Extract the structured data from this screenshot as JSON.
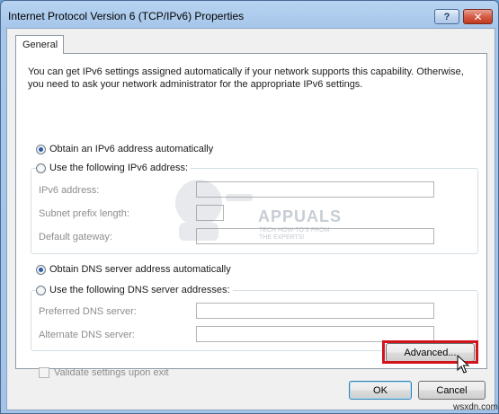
{
  "window": {
    "title": "Internet Protocol Version 6 (TCP/IPv6) Properties",
    "help_label": "?",
    "close_label": "✕"
  },
  "tabs": [
    {
      "label": "General",
      "selected": true
    }
  ],
  "intro_text": "You can get IPv6 settings assigned automatically if your network supports this capability. Otherwise, you need to ask your network administrator for the appropriate IPv6 settings.",
  "ip": {
    "auto_label": "Obtain an IPv6 address automatically",
    "manual_label": "Use the following IPv6 address:",
    "selected": "auto",
    "fields": [
      {
        "label": "IPv6 address:",
        "value": ""
      },
      {
        "label": "Subnet prefix length:",
        "value": ""
      },
      {
        "label": "Default gateway:",
        "value": ""
      }
    ]
  },
  "dns": {
    "auto_label": "Obtain DNS server address automatically",
    "manual_label": "Use the following DNS server addresses:",
    "selected": "auto",
    "fields": [
      {
        "label": "Preferred DNS server:",
        "value": ""
      },
      {
        "label": "Alternate DNS server:",
        "value": ""
      }
    ]
  },
  "validate_label": "Validate settings upon exit",
  "buttons": {
    "advanced": "Advanced...",
    "ok": "OK",
    "cancel": "Cancel"
  },
  "watermark": {
    "brand": "APPUALS",
    "tagline_1": "TECH HOW-TO'S FROM",
    "tagline_2": "THE EXPERTS!"
  },
  "site_caption": "wsxdn.com",
  "colors": {
    "highlight": "#d2141c",
    "radio_dot": "#2b5ea8"
  }
}
